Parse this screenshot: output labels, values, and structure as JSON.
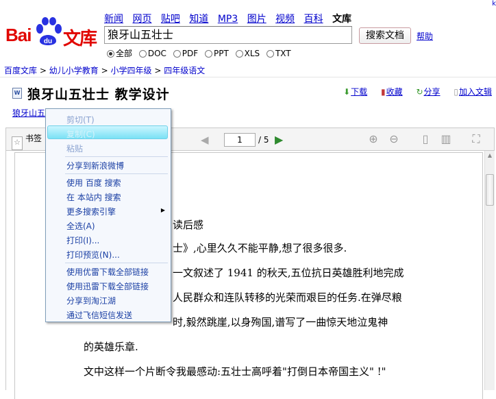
{
  "corner_link": "k",
  "logo": {
    "bai": "Bai",
    "du": "du",
    "wenku": "文库"
  },
  "nav": {
    "items": [
      "新闻",
      "网页",
      "贴吧",
      "知道",
      "MP3",
      "图片",
      "视频",
      "百科"
    ],
    "current": "文库"
  },
  "search": {
    "value": "狼牙山五壮士",
    "button": "搜索文档",
    "help": "帮助"
  },
  "filters": {
    "selected": "全部",
    "options": [
      "全部",
      "DOC",
      "PDF",
      "PPT",
      "XLS",
      "TXT"
    ]
  },
  "breadcrumb": [
    "百度文库",
    "幼儿小学教育",
    "小学四年级",
    "四年级语文"
  ],
  "breadcrumb_sep": ">",
  "doc": {
    "icon": "W",
    "title": "狼牙山五壮士 教学设计",
    "sub_link": "狼牙山五",
    "actions": {
      "download": "下载",
      "favorite": "收藏",
      "share": "分享",
      "add": "加入文辑"
    }
  },
  "toolbar": {
    "bookmark": "书签",
    "page": "1",
    "total": "/ 5"
  },
  "document_lines": [
    "读后感",
    "士》,心里久久不能平静,想了很多很多.",
    "一文叙述了 1941 的秋天,五位抗日英雄胜利地完成",
    "人民群众和连队转移的光荣而艰巨的任务.在弹尽粮",
    "时,毅然跳崖,以身殉国,谱写了一曲惊天地泣鬼神",
    "的英雄乐章.",
    "文中这样一个片断令我最感动:五壮士高呼着\"打倒日本帝国主义\" !\""
  ],
  "context_menu": {
    "groups": [
      [
        "剪切(T)",
        "复制(C)",
        "粘贴"
      ],
      [
        "分享到新浪微博"
      ],
      [
        "使用 百度 搜索",
        "在 本站内 搜索",
        "更多搜索引擎",
        "全选(A)",
        "打印(I)...",
        "打印预览(N)..."
      ],
      [
        "使用优雷下载全部链接",
        "使用迅雷下载全部链接",
        "分享到淘江湖",
        "通过飞信短信发送"
      ]
    ],
    "highlighted": "复制(C)"
  }
}
